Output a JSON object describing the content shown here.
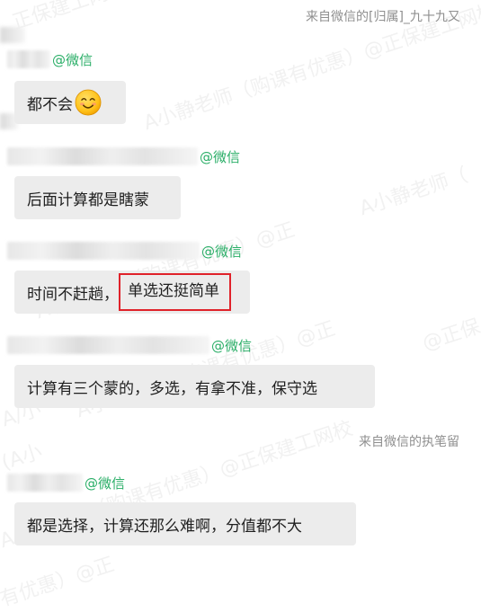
{
  "sources": {
    "top": "来自微信的[归属]_九十九又",
    "mid": "来自微信的执笔留"
  },
  "sender_tag": "@微信",
  "messages": [
    {
      "text": "都不会",
      "emoji": "smiling-face-icon"
    },
    {
      "text": "后面计算都是瞎蒙"
    },
    {
      "text_before": "时间不赶趟，",
      "text_highlight": "单选还挺简单"
    },
    {
      "text": "计算有三个蒙的，多选，有拿不准，保守选"
    },
    {
      "text": "都是选择，计算还那么难啊，分值都不大"
    }
  ],
  "watermarks": [
    "正保建工网校 7095",
    "A小静老师（购课有优惠）@正保建工网校",
    "A小静老师（",
    "A小静老师（购课有优惠）@正",
    "A小静老师（购课有优惠）@正",
    "A小静老师（购课有优惠）@正保建工网校",
    "(A小",
    "A/小",
    "有优惠）@正",
    "@正保"
  ],
  "colors": {
    "bubble": "#ececec",
    "sender_tag": "#2aae67",
    "highlight_border": "#e0222a",
    "source_text": "#8f8f8f"
  }
}
